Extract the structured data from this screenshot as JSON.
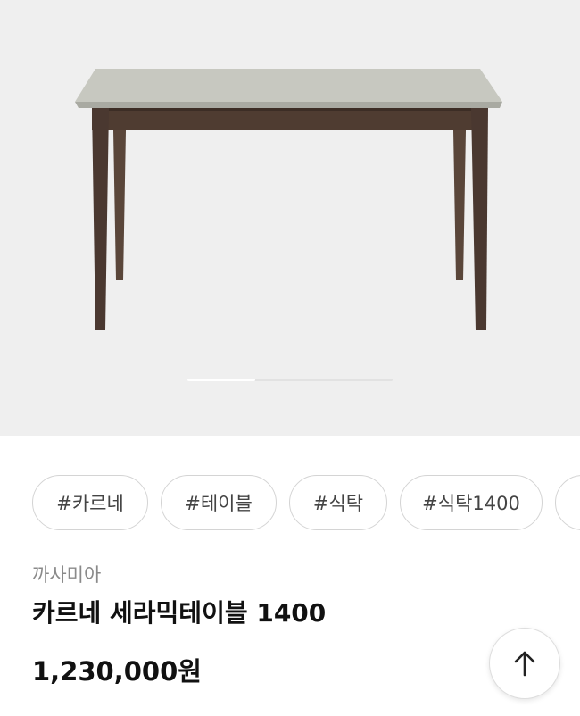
{
  "product": {
    "image_icon": "dining-table-image",
    "image_pager": {
      "active_fraction": 0.33
    },
    "tags": [
      "#카르네",
      "#테이블",
      "#식탁",
      "#식탁1400",
      "#"
    ],
    "brand": "까사미아",
    "name": "카르네 세라믹테이블 1400",
    "price": "1,230,000원"
  },
  "controls": {
    "scroll_top_icon": "arrow-up-icon"
  },
  "colors": {
    "image_background": "#efefef",
    "table_top": "#c6c6bf",
    "table_wood": "#4e3b30",
    "tag_border": "#d4d4d4"
  }
}
